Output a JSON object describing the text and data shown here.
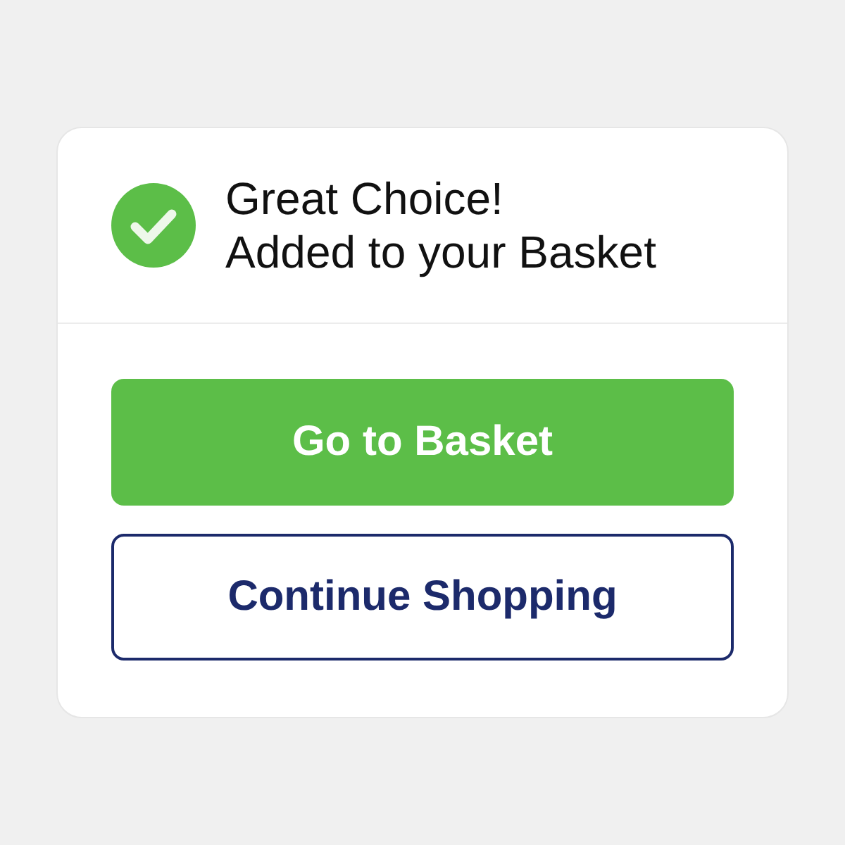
{
  "notice": {
    "title": "Great Choice!",
    "message": "Added to your Basket"
  },
  "buttons": [
    {
      "label": "Go to Basket",
      "kind": "primary"
    },
    {
      "label": "Continue Shopping",
      "kind": "secondary"
    }
  ]
}
